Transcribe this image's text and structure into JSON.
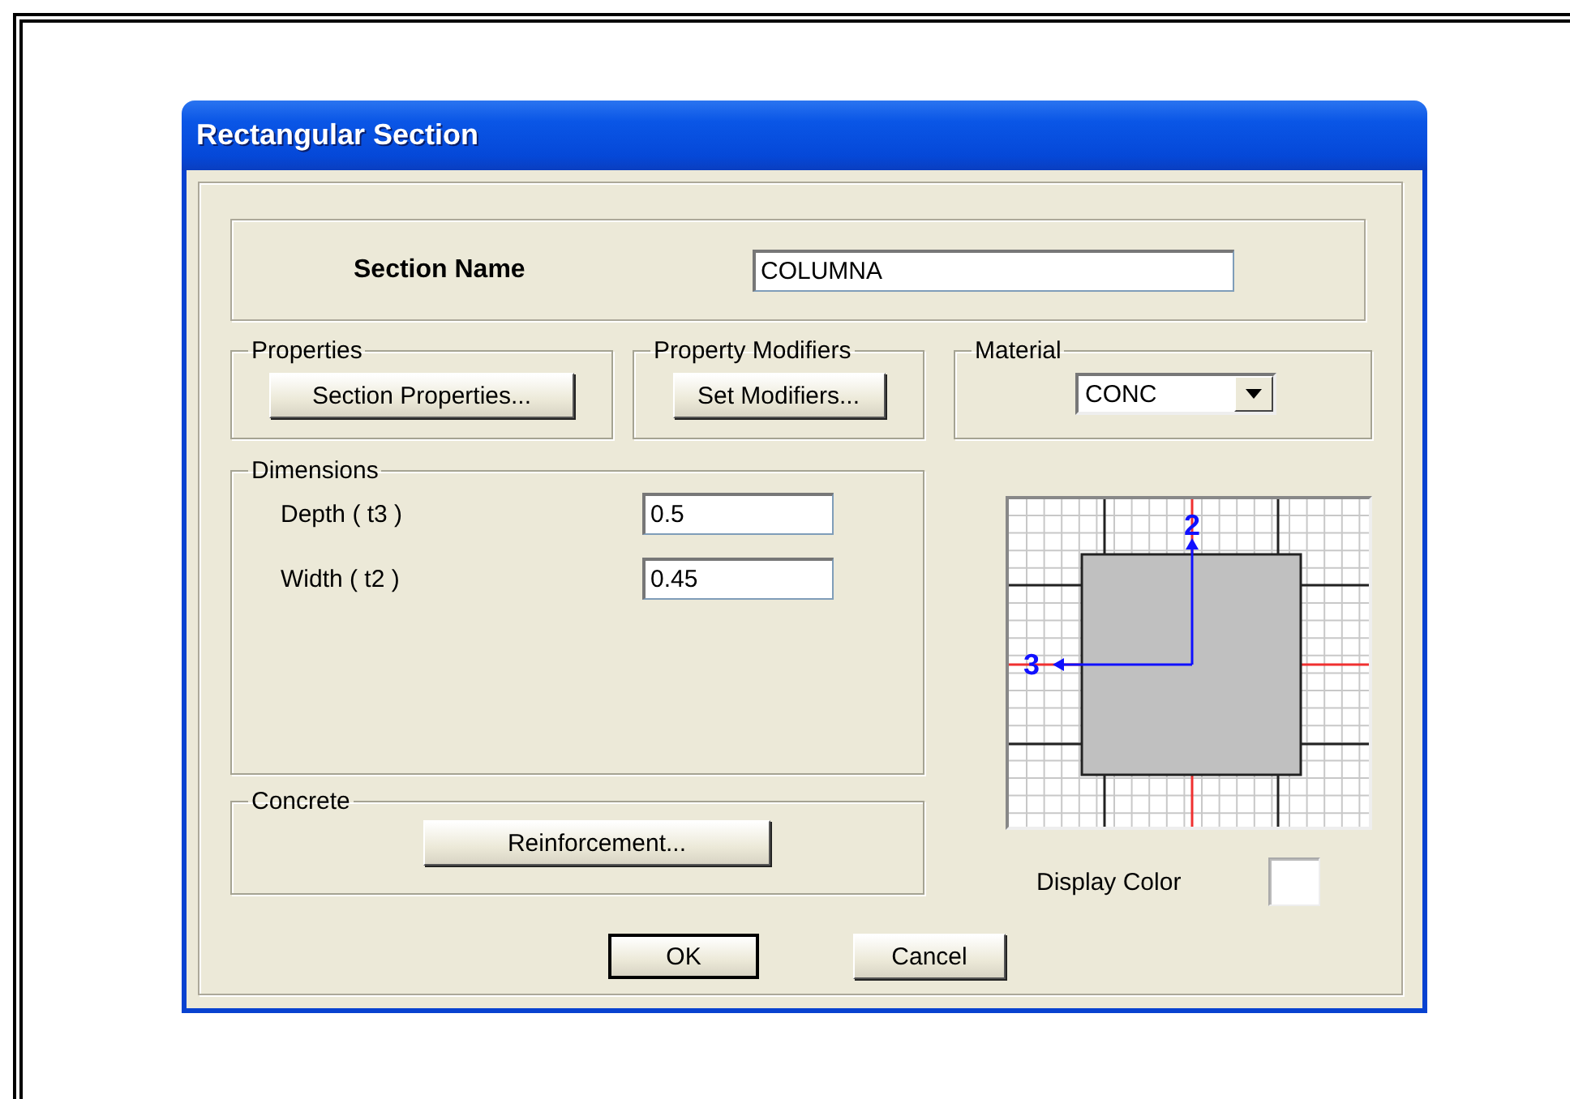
{
  "window": {
    "title": "Rectangular Section"
  },
  "section_name": {
    "label": "Section Name",
    "value": "COLUMNA"
  },
  "properties": {
    "legend": "Properties",
    "button": "Section Properties..."
  },
  "property_modifiers": {
    "legend": "Property Modifiers",
    "button": "Set Modifiers..."
  },
  "material": {
    "legend": "Material",
    "value": "CONC"
  },
  "dimensions": {
    "legend": "Dimensions",
    "fields": [
      {
        "label": "Depth ( t3 )",
        "value": "0.5"
      },
      {
        "label": "Width ( t2 )",
        "value": "0.45"
      }
    ]
  },
  "concrete": {
    "legend": "Concrete",
    "button": "Reinforcement..."
  },
  "section_preview": {
    "axis_labels": [
      "2",
      "3"
    ]
  },
  "display_color": {
    "label": "Display Color"
  },
  "buttons": [
    {
      "label": "OK",
      "default": true
    },
    {
      "label": "Cancel",
      "default": false
    }
  ]
}
